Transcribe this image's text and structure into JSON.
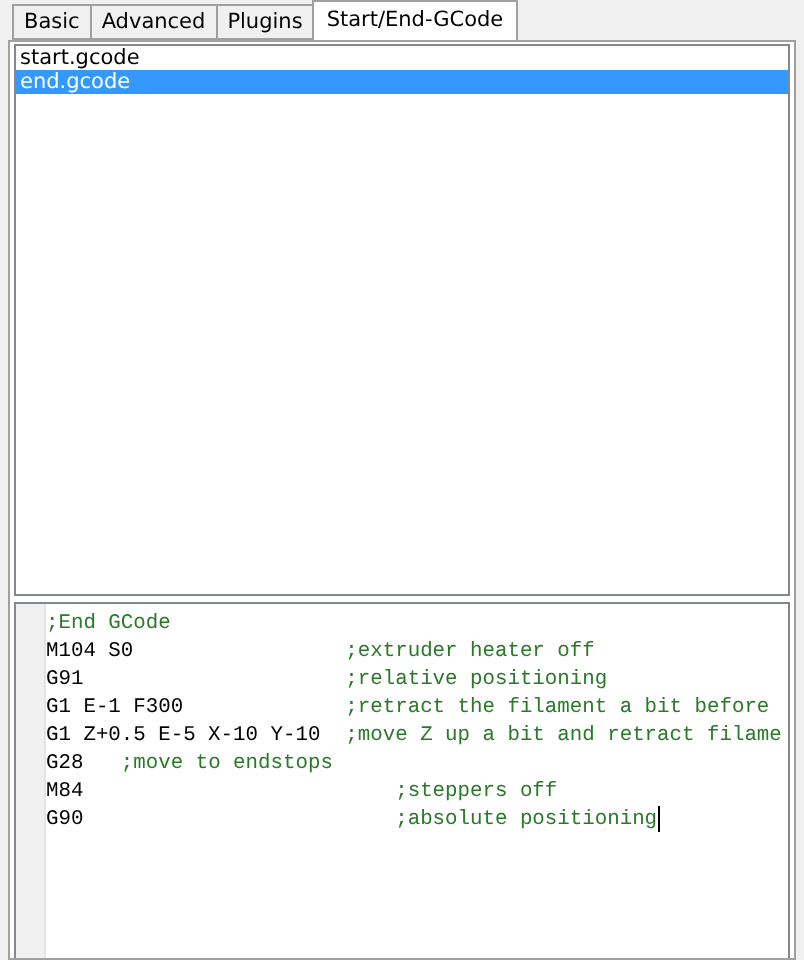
{
  "tabs": [
    {
      "label": "Basic",
      "selected": false
    },
    {
      "label": "Advanced",
      "selected": false
    },
    {
      "label": "Plugins",
      "selected": false
    },
    {
      "label": "Start/End-GCode",
      "selected": true
    }
  ],
  "files": [
    {
      "name": "start.gcode",
      "selected": false
    },
    {
      "name": "end.gcode",
      "selected": true
    }
  ],
  "editor": {
    "lines": [
      {
        "comment": ";End GCode"
      },
      {
        "code": "M104 S0                 ",
        "comment": ";extruder heater off"
      },
      {
        "code": "G91                     ",
        "comment": ";relative positioning"
      },
      {
        "code": "G1 E-1 F300             ",
        "comment": ";retract the filament a bit before"
      },
      {
        "code": "G1 Z+0.5 E-5 X-10 Y-10  ",
        "comment": ";move Z up a bit and retract filame"
      },
      {
        "code": "G28   ",
        "comment": ";move to endstops"
      },
      {
        "code": "M84                         ",
        "comment": ";steppers off"
      },
      {
        "code": "G90                         ",
        "comment": ";absolute positioning",
        "caret": true
      }
    ]
  }
}
